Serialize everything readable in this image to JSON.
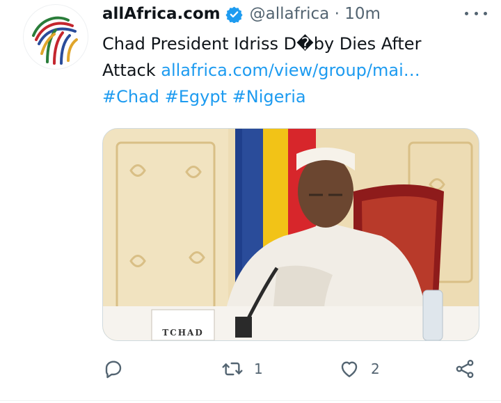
{
  "tweet": {
    "author_name": "allAfrica.com",
    "handle_and_time": "@allafrica · 10m",
    "text_line1": "Chad President Idriss D�by Dies After",
    "text_line2_plain": "Attack ",
    "link_text": "allafrica.com/view/group/mai…",
    "hashtags": "#Chad #Egypt #Nigeria",
    "media": {
      "nameplate_text": "TCHAD"
    }
  },
  "actions": {
    "retweet_count": "1",
    "like_count": "2"
  },
  "colors": {
    "link": "#1d9bf0",
    "verified": "#1d9bf0",
    "secondary_text": "#536471",
    "primary_text": "#0f1419"
  },
  "icons": [
    "verified-badge-icon",
    "more-options-icon",
    "reply-icon",
    "retweet-icon",
    "like-icon",
    "share-icon"
  ]
}
